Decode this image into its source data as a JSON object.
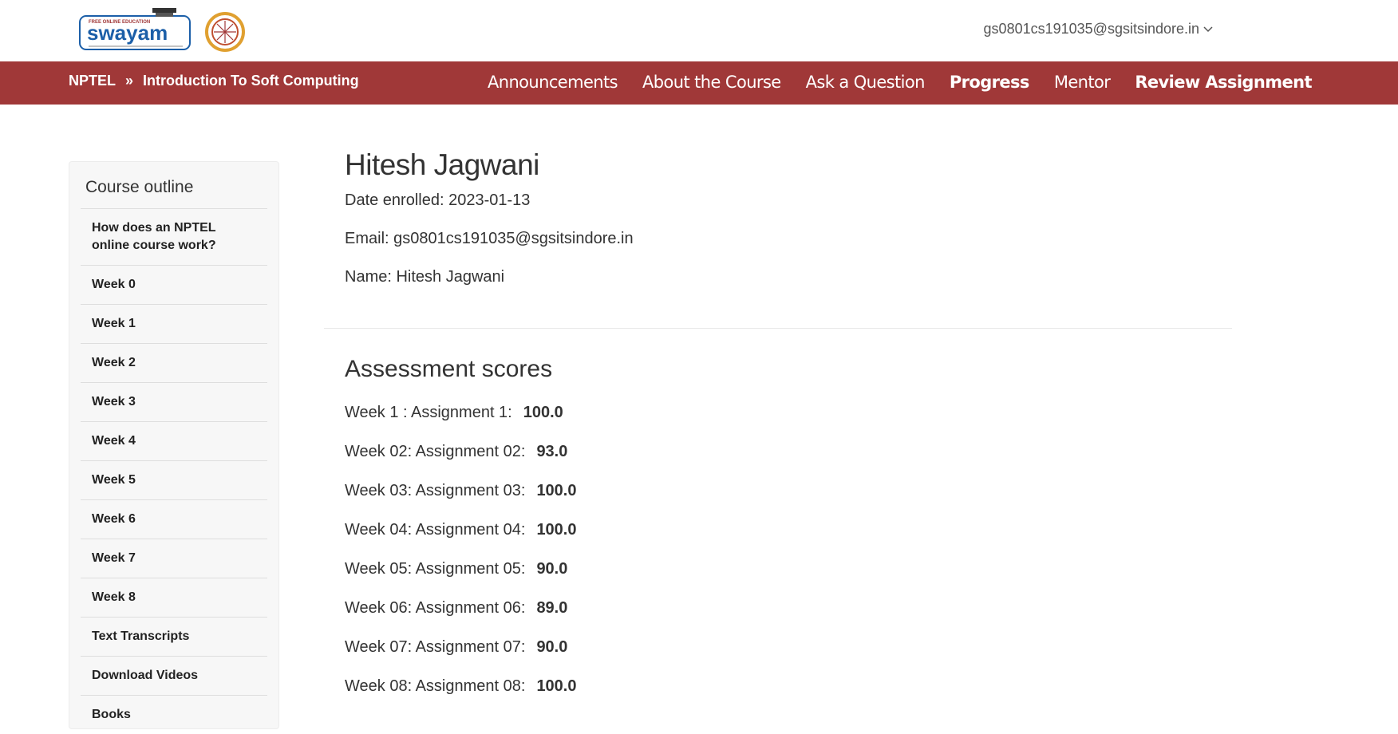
{
  "header": {
    "logo_text": "swayam",
    "logo_tagline": "FREE ONLINE EDUCATION",
    "user_email": "gs0801cs191035@sgsitsindore.in"
  },
  "breadcrumb": {
    "root": "NPTEL",
    "separator": "»",
    "course": "Introduction To Soft Computing"
  },
  "nav": [
    {
      "label": "Announcements"
    },
    {
      "label": "About the Course"
    },
    {
      "label": "Ask a Question"
    },
    {
      "label": "Progress"
    },
    {
      "label": "Mentor"
    },
    {
      "label": "Review Assignment"
    }
  ],
  "sidebar": {
    "title": "Course outline",
    "items": [
      {
        "label": "How does an NPTEL online course work?"
      },
      {
        "label": "Week 0"
      },
      {
        "label": "Week 1"
      },
      {
        "label": "Week 2"
      },
      {
        "label": "Week 3"
      },
      {
        "label": "Week 4"
      },
      {
        "label": "Week 5"
      },
      {
        "label": "Week 6"
      },
      {
        "label": "Week 7"
      },
      {
        "label": "Week 8"
      },
      {
        "label": "Text Transcripts"
      },
      {
        "label": "Download Videos"
      },
      {
        "label": "Books"
      }
    ]
  },
  "student": {
    "name": "Hitesh Jagwani",
    "date_enrolled": "Date enrolled: 2023-01-13",
    "email": "Email: gs0801cs191035@sgsitsindore.in",
    "name_line": "Name: Hitesh Jagwani"
  },
  "assessment": {
    "title": "Assessment scores",
    "scores": [
      {
        "label": "Week 1 : Assignment 1:",
        "value": "100.0"
      },
      {
        "label": "Week 02: Assignment 02:",
        "value": "93.0"
      },
      {
        "label": "Week 03: Assignment 03:",
        "value": "100.0"
      },
      {
        "label": "Week 04: Assignment 04:",
        "value": "100.0"
      },
      {
        "label": "Week 05: Assignment 05:",
        "value": "90.0"
      },
      {
        "label": "Week 06: Assignment 06:",
        "value": "89.0"
      },
      {
        "label": "Week 07: Assignment 07:",
        "value": "90.0"
      },
      {
        "label": "Week 08: Assignment 08:",
        "value": "100.0"
      }
    ]
  },
  "colors": {
    "navbar": "#a03838",
    "logo_blue": "#1c5fa8"
  }
}
